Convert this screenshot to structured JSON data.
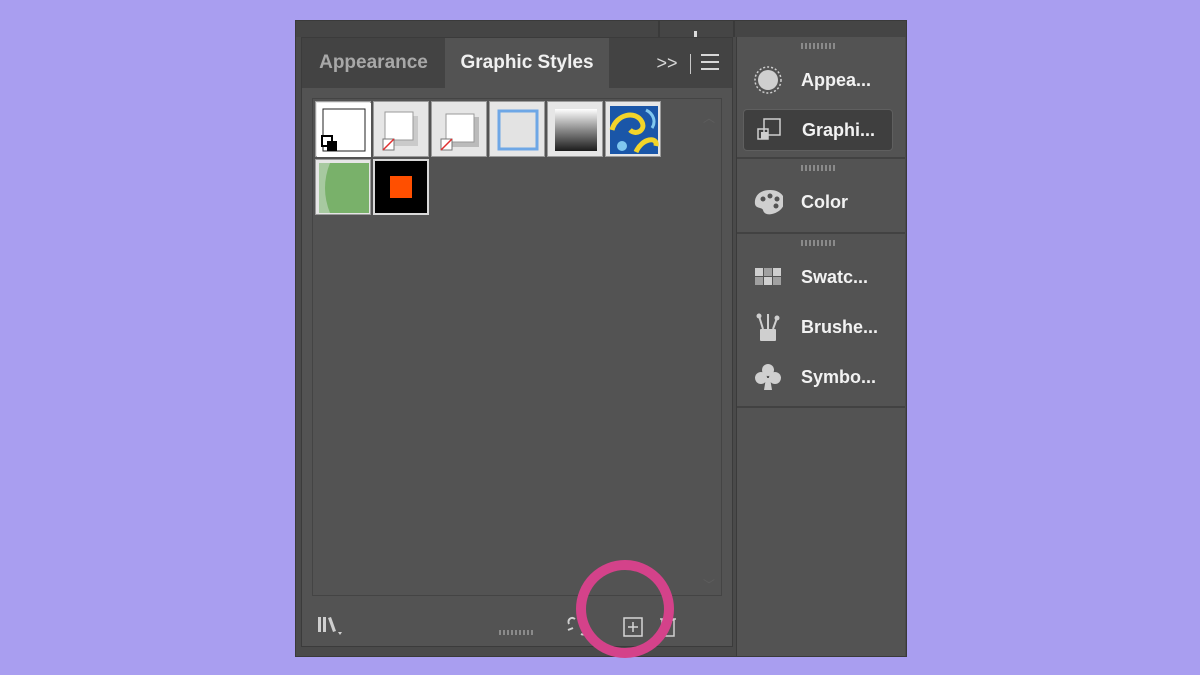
{
  "panel": {
    "tabs": [
      {
        "label": "Appearance",
        "active": false
      },
      {
        "label": "Graphic Styles",
        "active": true
      }
    ],
    "collapse_glyph": ">>",
    "menu_icon": "hamburger-menu-icon"
  },
  "graphic_styles": [
    {
      "name": "default-style",
      "icon": "default-style-icon"
    },
    {
      "name": "shadow-style-1",
      "icon": "shadow-style-icon"
    },
    {
      "name": "shadow-style-2",
      "icon": "shadow-style-icon"
    },
    {
      "name": "blue-outline-style",
      "icon": "blue-outline-icon"
    },
    {
      "name": "gradient-style",
      "icon": "gradient-icon"
    },
    {
      "name": "pattern-style",
      "icon": "swirl-pattern-icon"
    },
    {
      "name": "green-shape-style",
      "icon": "green-shape-icon"
    },
    {
      "name": "orange-square-style",
      "icon": "orange-square-icon",
      "selected": true
    }
  ],
  "footer": {
    "library_icon": "graphic-styles-library-icon",
    "break_link_icon": "break-link-icon",
    "new_style_icon": "new-graphic-style-icon",
    "delete_icon": "delete-icon"
  },
  "dock": {
    "items": [
      {
        "label": "Appea...",
        "icon": "appearance-icon",
        "active": false
      },
      {
        "label": "Graphi...",
        "icon": "graphic-styles-icon",
        "active": true
      },
      {
        "label": "Color",
        "icon": "color-palette-icon",
        "active": false
      },
      {
        "label": "Swatc...",
        "icon": "swatches-icon",
        "active": false
      },
      {
        "label": "Brushe...",
        "icon": "brushes-icon",
        "active": false
      },
      {
        "label": "Symbo...",
        "icon": "symbols-icon",
        "active": false
      }
    ]
  },
  "colors": {
    "background": "#a99ef0",
    "panel": "#535353",
    "highlight": "#d4428a",
    "selected_swatch_fill": "#ff4f00"
  }
}
